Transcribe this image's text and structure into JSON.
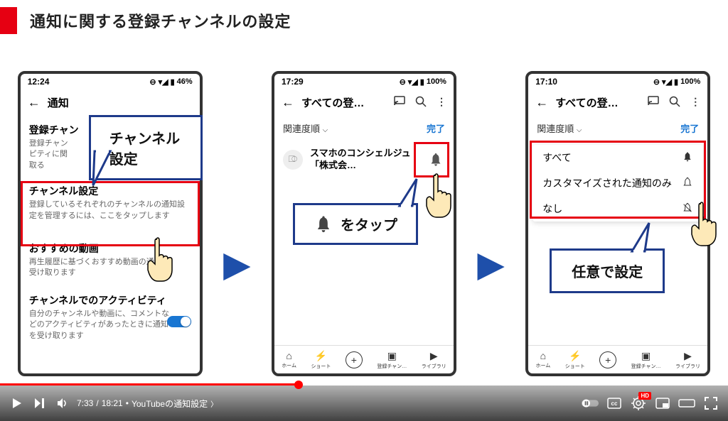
{
  "slide": {
    "title": "通知に関する登録チャンネルの設定"
  },
  "phone1": {
    "time": "12:24",
    "battery": "46%",
    "header": "通知",
    "sec1_title": "登録チャン",
    "sec1_desc1": "登録チャン",
    "sec1_desc2": "ピティに関",
    "sec1_desc3": "取る",
    "sec2_title": "チャンネル設定",
    "sec2_desc": "登録しているそれぞれのチャンネルの通知設定を管理するには、ここをタップします",
    "sec3_title": "おすすめの動画",
    "sec3_desc": "再生履歴に基づくおすすめ動画の通知を受け取ります",
    "sec4_title": "チャンネルでのアクティビティ",
    "sec4_desc": "自分のチャンネルや動画に、コメントなどのアクティビティがあったときに通知を受け取ります"
  },
  "callout1": "チャンネル設定",
  "phone2": {
    "time": "17:29",
    "battery": "100%",
    "header": "すべての登…",
    "sort": "関連度順",
    "done": "完了",
    "channel": "スマホのコンシェルジュ「株式会…",
    "nav": {
      "home": "ホーム",
      "shorts": "ショート",
      "subs": "登録チャン…",
      "library": "ライブラリ"
    }
  },
  "callout2": "をタップ",
  "phone3": {
    "time": "17:10",
    "battery": "100%",
    "header": "すべての登…",
    "sort": "関連度順",
    "done": "完了",
    "opt1": "すべて",
    "opt2": "カスタマイズされた通知のみ",
    "opt3": "なし",
    "nav": {
      "home": "ホーム",
      "shorts": "ショート",
      "subs": "登録チャン…",
      "library": "ライブラリ"
    }
  },
  "callout3": "任意で設定",
  "youtube": {
    "time_current": "7:33",
    "time_total": "18:21",
    "chapter": "YouTubeの通知設定",
    "hd": "HD"
  }
}
